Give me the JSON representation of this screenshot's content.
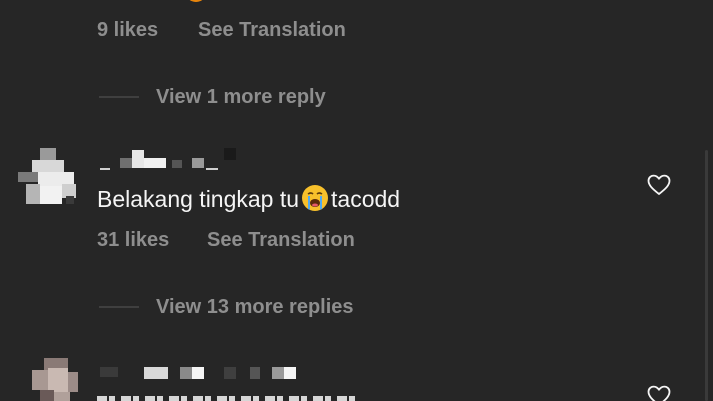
{
  "comment_prev": {
    "likes": "9 likes",
    "see_translation": "See Translation"
  },
  "thread_1": {
    "view_more": "View 1 more reply"
  },
  "comment_main": {
    "text_before": "Belakang tingkap tu",
    "emoji": "loudly-crying-face",
    "text_after": "tacodd",
    "likes": "31 likes",
    "see_translation": "See Translation",
    "view_more": "View 13 more replies",
    "like_icon": "heart-outline-icon"
  },
  "comment_next": {
    "like_icon": "heart-outline-icon"
  },
  "colors": {
    "background": "#262626",
    "text_primary": "#f5f5f5",
    "text_secondary": "#8e8e8e"
  }
}
